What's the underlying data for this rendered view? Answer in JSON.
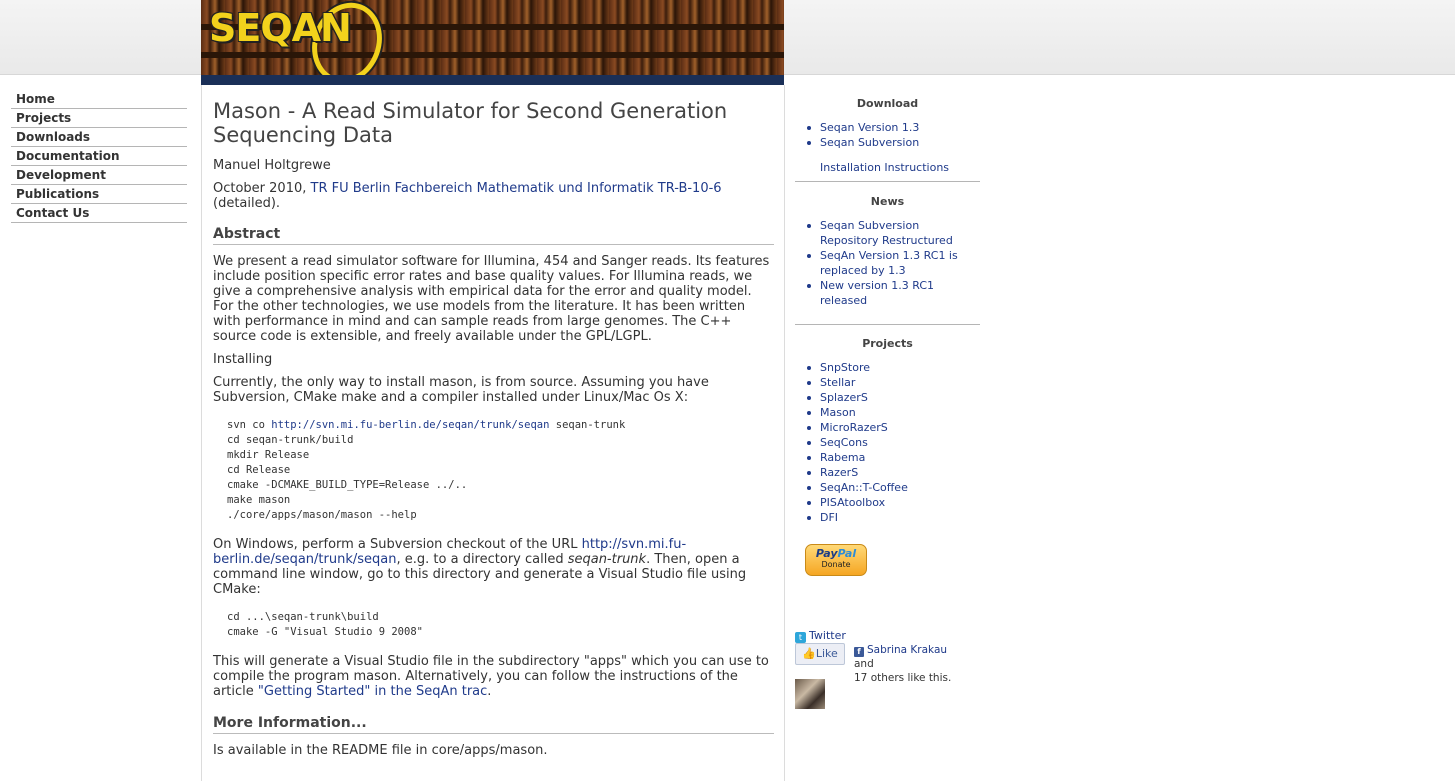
{
  "logo": {
    "text": "SEQAN"
  },
  "nav": {
    "items": [
      {
        "label": "Home"
      },
      {
        "label": "Projects"
      },
      {
        "label": "Downloads"
      },
      {
        "label": "Documentation"
      },
      {
        "label": "Development"
      },
      {
        "label": "Publications"
      },
      {
        "label": "Contact Us"
      }
    ]
  },
  "main": {
    "title": "Mason - A Read Simulator for Second Generation Sequencing Data",
    "author": "Manuel Holtgrewe",
    "date_prefix": "October 2010, ",
    "report_link": "TR FU Berlin Fachbereich Mathematik und Informatik TR-B-10-6",
    "detailed": " (detailed).",
    "abstract_heading": "Abstract",
    "abstract_text": "We present a read simulator software for Illumina, 454 and Sanger reads. Its features include position specific error rates and base quality values. For Illumina reads, we give a comprehensive analysis with empirical data for the error and quality model. For the other technologies, we use models from the literature. It has been written with performance in mind and can sample reads from large genomes. The C++ source code is extensible, and freely available under the GPL/LGPL.",
    "installing_label": "Installing",
    "install_text": "Currently, the only way to install mason, is from source. Assuming you have Subversion, CMake make and a compiler installed under Linux/Mac Os X:",
    "code1_prefix": "svn co ",
    "code1_url": "http://svn.mi.fu-berlin.de/seqan/trunk/seqan",
    "code1_suffix": " seqan-trunk",
    "code1_rest": "cd seqan-trunk/build\nmkdir Release\ncd Release\ncmake -DCMAKE_BUILD_TYPE=Release ../..\nmake mason\n./core/apps/mason/mason --help",
    "windows_prefix": "On Windows, perform a Subversion checkout of the URL ",
    "windows_url": "http://svn.mi.fu-berlin.de/seqan/trunk/seqan",
    "windows_mid": ", e.g. to a directory called ",
    "windows_dir": "seqan-trunk",
    "windows_suffix": ". Then, open a command line window, go to this directory and generate a Visual Studio file using CMake:",
    "code2": "cd ...\\seqan-trunk\\build\ncmake -G \"Visual Studio 9 2008\"",
    "vs_prefix": "This will generate a Visual Studio file in the subdirectory \"apps\" which you can use to compile the program mason. Alternatively, you can follow the instructions of the article ",
    "vs_link": "\"Getting Started\" in the SeqAn trac",
    "vs_suffix": ".",
    "more_heading": "More Information...",
    "more_text": "Is available in the README file in core/apps/mason."
  },
  "sidebar": {
    "download": {
      "heading": "Download",
      "items": [
        {
          "label": "Seqan Version 1.3"
        },
        {
          "label": "Seqan Subversion"
        }
      ],
      "install_link": "Installation Instructions"
    },
    "news": {
      "heading": "News",
      "items": [
        {
          "label": "Seqan Subversion Repository Restructured"
        },
        {
          "label": "SeqAn Version 1.3 RC1 is replaced by 1.3"
        },
        {
          "label": "New version 1.3 RC1 released"
        }
      ]
    },
    "projects": {
      "heading": "Projects",
      "items": [
        {
          "label": "SnpStore"
        },
        {
          "label": "Stellar"
        },
        {
          "label": "SplazerS"
        },
        {
          "label": "Mason"
        },
        {
          "label": "MicroRazerS"
        },
        {
          "label": "SeqCons"
        },
        {
          "label": "Rabema"
        },
        {
          "label": "RazerS"
        },
        {
          "label": "SeqAn::T-Coffee"
        },
        {
          "label": "PISAtoolbox"
        },
        {
          "label": "DFI"
        }
      ]
    },
    "paypal": {
      "brand_a": "Pay",
      "brand_b": "Pal",
      "label": "Donate"
    },
    "twitter": {
      "label": "Twitter"
    },
    "facebook": {
      "like_label": "Like",
      "name": "Sabrina Krakau",
      "and": " and",
      "others": "17 others like this."
    }
  },
  "colors": {
    "link": "#1f3a8a",
    "header_bar": "#1a2f57",
    "logo_yellow": "#f2d21c"
  }
}
